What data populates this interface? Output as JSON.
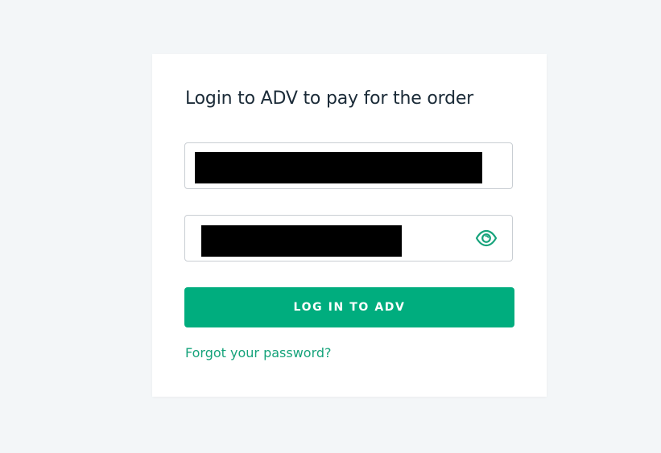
{
  "card": {
    "title": "Login to ADV to pay for the order"
  },
  "form": {
    "login_value": "",
    "password_value": "",
    "submit_label": "LOG IN TO ADV",
    "forgot_label": "Forgot your password?"
  },
  "icons": {
    "password_toggle": "eye-icon"
  },
  "colors": {
    "background": "#f3f6f8",
    "card": "#ffffff",
    "accent": "#00ad7e",
    "link": "#16a37b",
    "title_text": "#1b2b38",
    "redaction": "#000000"
  }
}
